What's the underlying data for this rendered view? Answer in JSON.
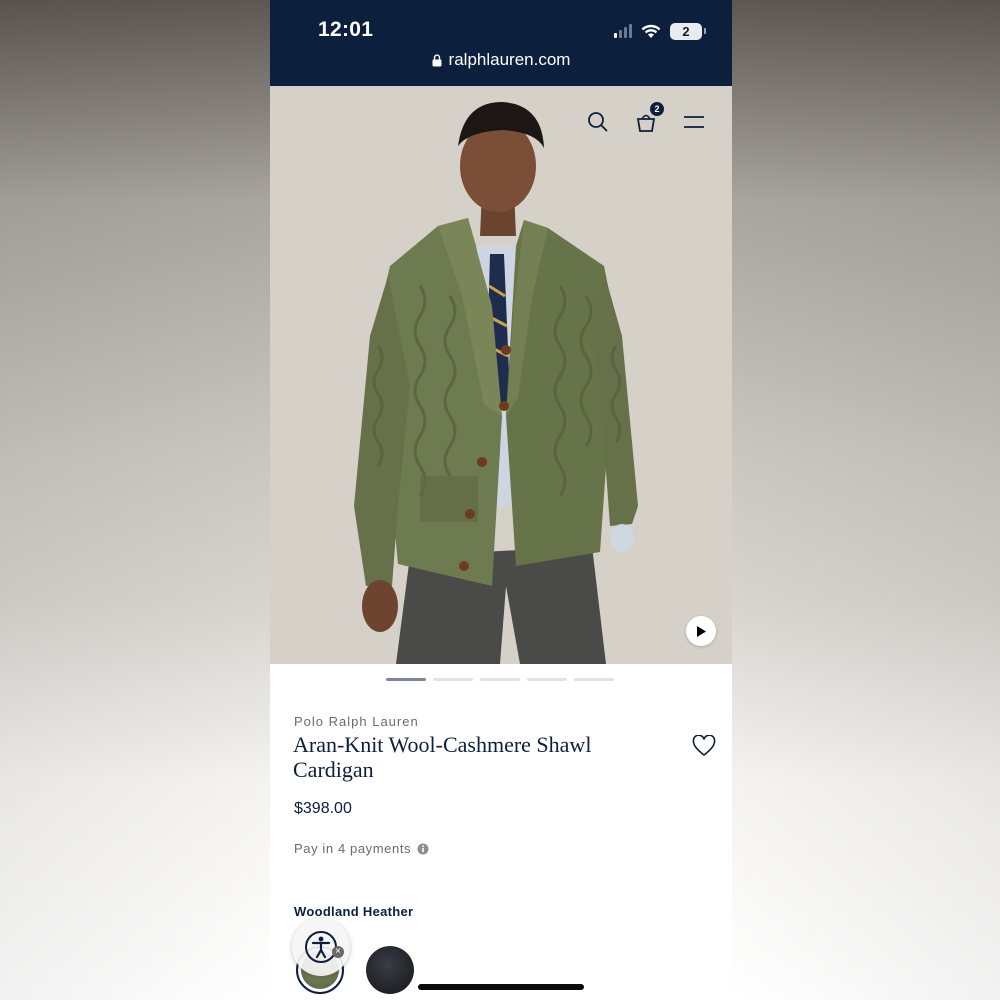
{
  "status_bar": {
    "time": "12:01",
    "battery": "2",
    "signal_icon": "cellular-signal-icon",
    "wifi_icon": "wifi-icon"
  },
  "browser": {
    "url": "ralphlauren.com",
    "lock_icon": "lock-icon"
  },
  "header_icons": {
    "search_icon": "search-icon",
    "cart_icon": "shopping-bag-icon",
    "cart_count": "2",
    "menu_icon": "hamburger-menu-icon"
  },
  "gallery": {
    "image_alt": "Model wearing green cable-knit shawl cardigan",
    "play_icon": "play-icon",
    "active_index": 1,
    "total": 5
  },
  "product": {
    "brand": "Polo Ralph Lauren",
    "title": "Aran-Knit Wool-Cashmere Shawl Cardigan",
    "price": "$398.00",
    "payments": "Pay in 4 payments",
    "info_icon": "info-icon",
    "wishlist_icon": "heart-icon",
    "color_name": "Woodland Heather",
    "colors": [
      {
        "name": "Woodland Heather",
        "hex": "#6b744f",
        "selected": true
      },
      {
        "name": "",
        "hex": "#24262b",
        "selected": false
      }
    ]
  },
  "accessibility_widget": {
    "icon": "accessibility-icon",
    "close_icon": "close-icon"
  },
  "colors": {
    "navy": "#0c1f3d",
    "sweater": "#6e7a4f"
  }
}
